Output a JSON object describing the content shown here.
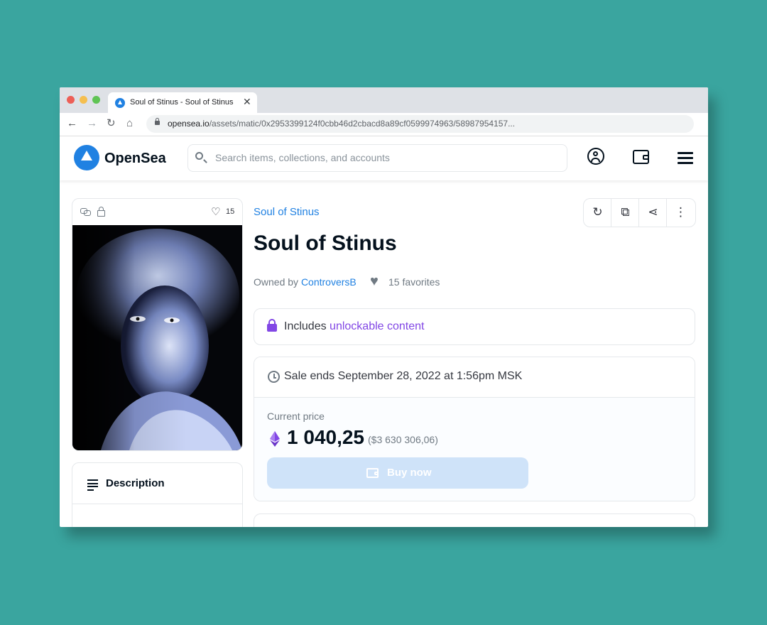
{
  "browser": {
    "tab_title": "Soul of Stinus - Soul of Stinus",
    "url_domain": "opensea.io",
    "url_path": "/assets/matic/0x2953399124f0cbb46d2cbacd8a89cf0599974963/58987954157..."
  },
  "header": {
    "logo_text": "OpenSea",
    "search_placeholder": "Search items, collections, and accounts"
  },
  "item": {
    "favorites_count": "15",
    "collection_name": "Soul of Stinus",
    "title": "Soul of Stinus",
    "owned_by_label": "Owned by",
    "owner": "ControversB",
    "favorites_text": "15 favorites",
    "unlock_prefix": "Includes",
    "unlock_link": "unlockable content",
    "sale_ends": "Sale ends September 28, 2022 at 1:56pm MSK",
    "current_price_label": "Current price",
    "price": "1 040,25",
    "price_usd": "($3 630 306,06)",
    "buy_label": "Buy now",
    "description_title": "Description"
  },
  "colors": {
    "page_background": "#3aa59f",
    "accent": "#2081e2",
    "purple": "#8247e5",
    "buy_button": "#cfe3f9"
  }
}
